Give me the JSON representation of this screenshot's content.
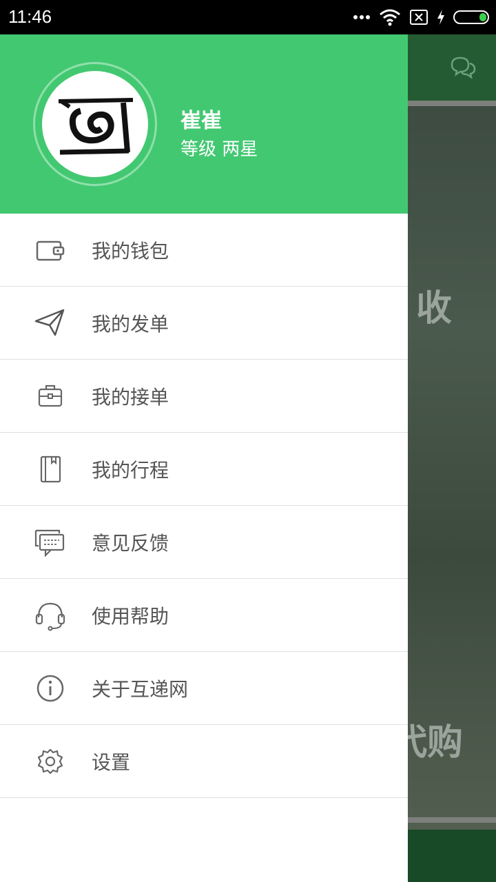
{
  "status_bar": {
    "time": "11:46",
    "icons": [
      "more-dots-icon",
      "wifi-icon",
      "no-sim-icon",
      "charging-icon",
      "battery-icon"
    ]
  },
  "profile": {
    "name": "崔崔",
    "level": "等级 两星",
    "avatar_icon": "hudi-logo-icon"
  },
  "menu": [
    {
      "label": "我的钱包",
      "icon": "wallet-icon"
    },
    {
      "label": "我的发单",
      "icon": "paper-plane-icon"
    },
    {
      "label": "我的接单",
      "icon": "briefcase-icon"
    },
    {
      "label": "我的行程",
      "icon": "notebook-icon"
    },
    {
      "label": "意见反馈",
      "icon": "feedback-icon"
    },
    {
      "label": "使用帮助",
      "icon": "headset-icon"
    },
    {
      "label": "关于互递网",
      "icon": "info-icon"
    },
    {
      "label": "设置",
      "icon": "settings-icon"
    }
  ],
  "background": {
    "text_receive": "收",
    "text_purchase": "代购",
    "chat_icon": "chat-icon"
  },
  "colors": {
    "header_green": "#43c872",
    "menu_text": "#555555",
    "divider": "#e0e0e0"
  }
}
